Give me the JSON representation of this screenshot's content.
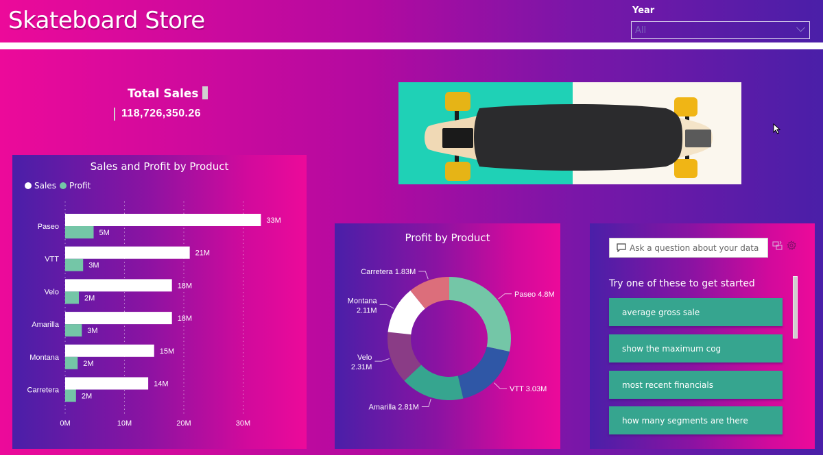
{
  "header": {
    "title": "Skateboard Store"
  },
  "slicer": {
    "label": "Year",
    "selected": "All"
  },
  "kpi": {
    "title": "Total Sales",
    "value": "118,726,350.26"
  },
  "image": {
    "alt": "Longboard skateboard with yellow wheels on teal and cream background",
    "colors": {
      "teal": "#1fd1b6",
      "cream": "#fbf7ee",
      "deck": "#2b2b2d",
      "wheel": "#e6b416",
      "wood": "#f0d9b5"
    }
  },
  "colors": {
    "sales": "#ffffff",
    "profit": "#74c6a7",
    "pink": "#ec0a9a",
    "indigo": "#4a1fa8",
    "qa_button": "#36a58f"
  },
  "chart_data": [
    {
      "type": "bar",
      "orientation": "horizontal",
      "title": "Sales and Profit by Product",
      "categories": [
        "Paseo",
        "VTT",
        "Velo",
        "Amarilla",
        "Montana",
        "Carretera"
      ],
      "series": [
        {
          "name": "Sales",
          "color": "#ffffff",
          "values": [
            33,
            21,
            18,
            18,
            15,
            14
          ],
          "labels": [
            "33M",
            "21M",
            "18M",
            "18M",
            "15M",
            "14M"
          ]
        },
        {
          "name": "Profit",
          "color": "#74c6a7",
          "values": [
            4.8,
            3.03,
            2.31,
            2.81,
            2.11,
            1.83
          ],
          "labels": [
            "5M",
            "3M",
            "2M",
            "3M",
            "2M",
            "2M"
          ]
        }
      ],
      "xlabel": "",
      "ylabel": "",
      "xlim": [
        0,
        40
      ],
      "xticks": [
        0,
        10,
        20,
        30
      ],
      "xtick_labels": [
        "0M",
        "10M",
        "20M",
        "30M"
      ],
      "legend": "top-left",
      "grid": "vertical-dotted"
    },
    {
      "type": "pie",
      "donut": true,
      "title": "Profit by Product",
      "slices": [
        {
          "label": "Paseo",
          "value": 4.8,
          "display": "Paseo 4.8M",
          "color": "#74c6a7"
        },
        {
          "label": "VTT",
          "value": 3.03,
          "display": "VTT 3.03M",
          "color": "#2f57a6"
        },
        {
          "label": "Amarilla",
          "value": 2.81,
          "display": "Amarilla 2.81M",
          "color": "#36a58f"
        },
        {
          "label": "Velo",
          "value": 2.31,
          "display": "Velo 2.31M",
          "color": "#8a3c86"
        },
        {
          "label": "Montana",
          "value": 2.11,
          "display": "Montana 2.11M",
          "color": "#ffffff"
        },
        {
          "label": "Carretera",
          "value": 1.83,
          "display": "Carretera 1.83M",
          "color": "#dc6e7b"
        }
      ]
    }
  ],
  "qa": {
    "placeholder": "Ask a question about your data",
    "heading": "Try one of these to get started",
    "suggestions": [
      "average gross sale",
      "show the maximum cog",
      "most recent financials",
      "how many segments are there"
    ]
  }
}
